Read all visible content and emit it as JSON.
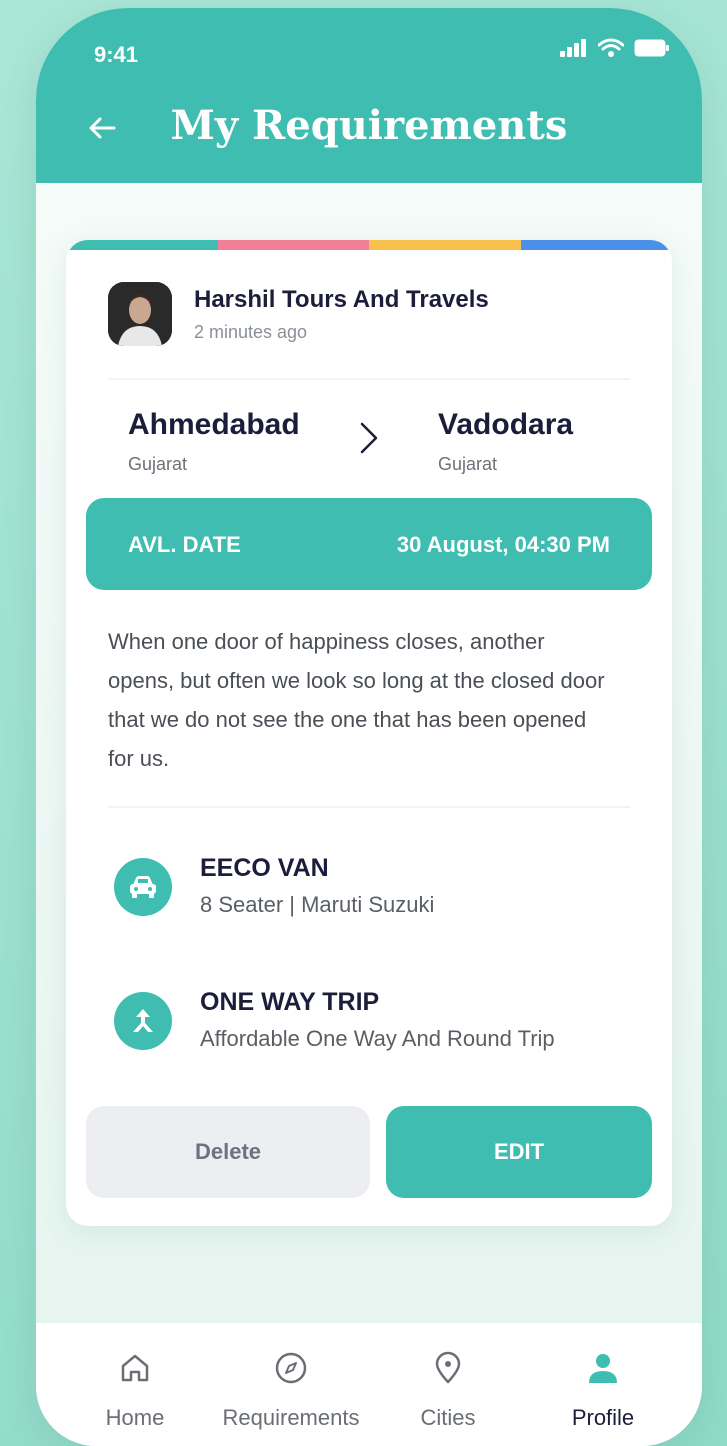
{
  "status_bar": {
    "time": "9:41"
  },
  "header": {
    "title": "My Requirements"
  },
  "colors": {
    "primary": "#3ebdb0",
    "stripe": [
      "#3ebdb0",
      "#f27f98",
      "#f7c14c",
      "#4a8fe8"
    ]
  },
  "card": {
    "company": "Harshil Tours And Travels",
    "time_ago": "2 minutes ago",
    "from": {
      "city": "Ahmedabad",
      "state": "Gujarat"
    },
    "to": {
      "city": "Vadodara",
      "state": "Gujarat"
    },
    "date_label": "AVL. DATE",
    "date_value": "30 August, 04:30 PM",
    "description": "When one door of happiness closes, another opens, but often we look so long at the closed door that we do not see the one that has been opened for us.",
    "vehicle": {
      "title": "EECO VAN",
      "subtitle": "8 Seater |  Maruti Suzuki",
      "icon": "car-icon"
    },
    "trip": {
      "title": "ONE WAY TRIP",
      "subtitle": "Affordable One Way And Round Trip",
      "icon": "one-way-icon"
    },
    "delete_label": "Delete",
    "edit_label": "EDIT"
  },
  "tabbar": {
    "items": [
      {
        "label": "Home",
        "icon": "home-icon"
      },
      {
        "label": "Requirements",
        "icon": "compass-icon"
      },
      {
        "label": "Cities",
        "icon": "location-icon"
      },
      {
        "label": "Profile",
        "icon": "profile-icon",
        "active": true
      }
    ]
  }
}
